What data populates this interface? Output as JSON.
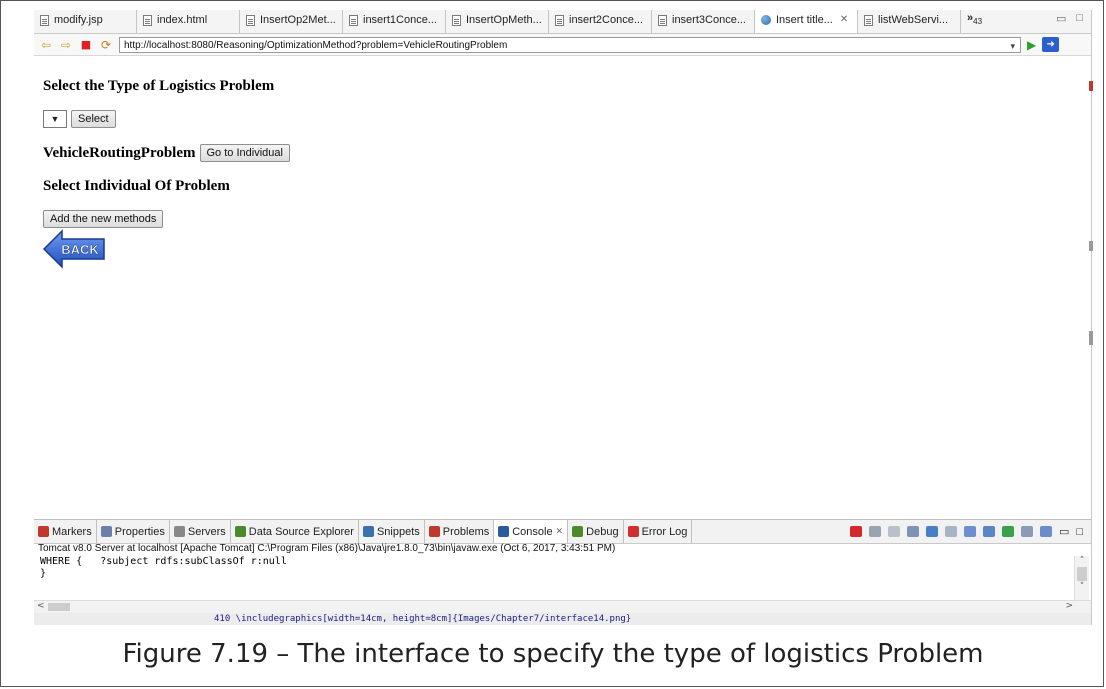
{
  "tabs": [
    {
      "label": "modify.jsp",
      "icon": "file-icon"
    },
    {
      "label": "index.html",
      "icon": "file-icon"
    },
    {
      "label": "InsertOp2Met...",
      "icon": "file-icon"
    },
    {
      "label": "insert1Conce...",
      "icon": "file-icon"
    },
    {
      "label": "InsertOpMeth...",
      "icon": "file-icon"
    },
    {
      "label": "insert2Conce...",
      "icon": "file-icon"
    },
    {
      "label": "insert3Conce...",
      "icon": "file-icon"
    },
    {
      "label": "Insert title...",
      "icon": "globe-icon",
      "active": true
    },
    {
      "label": "listWebServi...",
      "icon": "file-icon"
    }
  ],
  "tab_overflow": {
    "label": "»",
    "count": "43"
  },
  "address": {
    "url": "http://localhost:8080/Reasoning/OptimizationMethod?problem=VehicleRoutingProblem"
  },
  "page": {
    "heading_type": "Select the Type of Logistics Problem",
    "select_button": "Select",
    "problem_name": "VehicleRoutingProblem",
    "go_button": "Go to Individual",
    "heading_individual": "Select Individual Of Problem",
    "add_button": "Add the new methods",
    "back_label": "BACK"
  },
  "panel": {
    "tabs": [
      {
        "label": "Markers",
        "color": "#c0392b"
      },
      {
        "label": "Properties",
        "color": "#6b7fa8"
      },
      {
        "label": "Servers",
        "color": "#888888"
      },
      {
        "label": "Data Source Explorer",
        "color": "#4a8a2a"
      },
      {
        "label": "Snippets",
        "color": "#3a6fb0"
      },
      {
        "label": "Problems",
        "color": "#c0392b"
      },
      {
        "label": "Console",
        "color": "#2c5aa0",
        "active": true
      },
      {
        "label": "Debug",
        "color": "#4a8a2a"
      },
      {
        "label": "Error Log",
        "color": "#d03030"
      }
    ],
    "status": "Tomcat v8.0 Server at localhost [Apache Tomcat] C:\\Program Files (x86)\\Java\\jre1.8.0_73\\bin\\javaw.exe (Oct 6, 2017, 3:43:51 PM)",
    "console_lines": [
      "WHERE {   ?subject rdfs:subClassOf r:null",
      "}"
    ],
    "editor_snippet": "410   \\includegraphics[width=14cm, height=8cm]{Images/Chapter7/interface14.png}"
  },
  "caption": "Figure 7.19 – The interface to specify the type of logistics Problem"
}
